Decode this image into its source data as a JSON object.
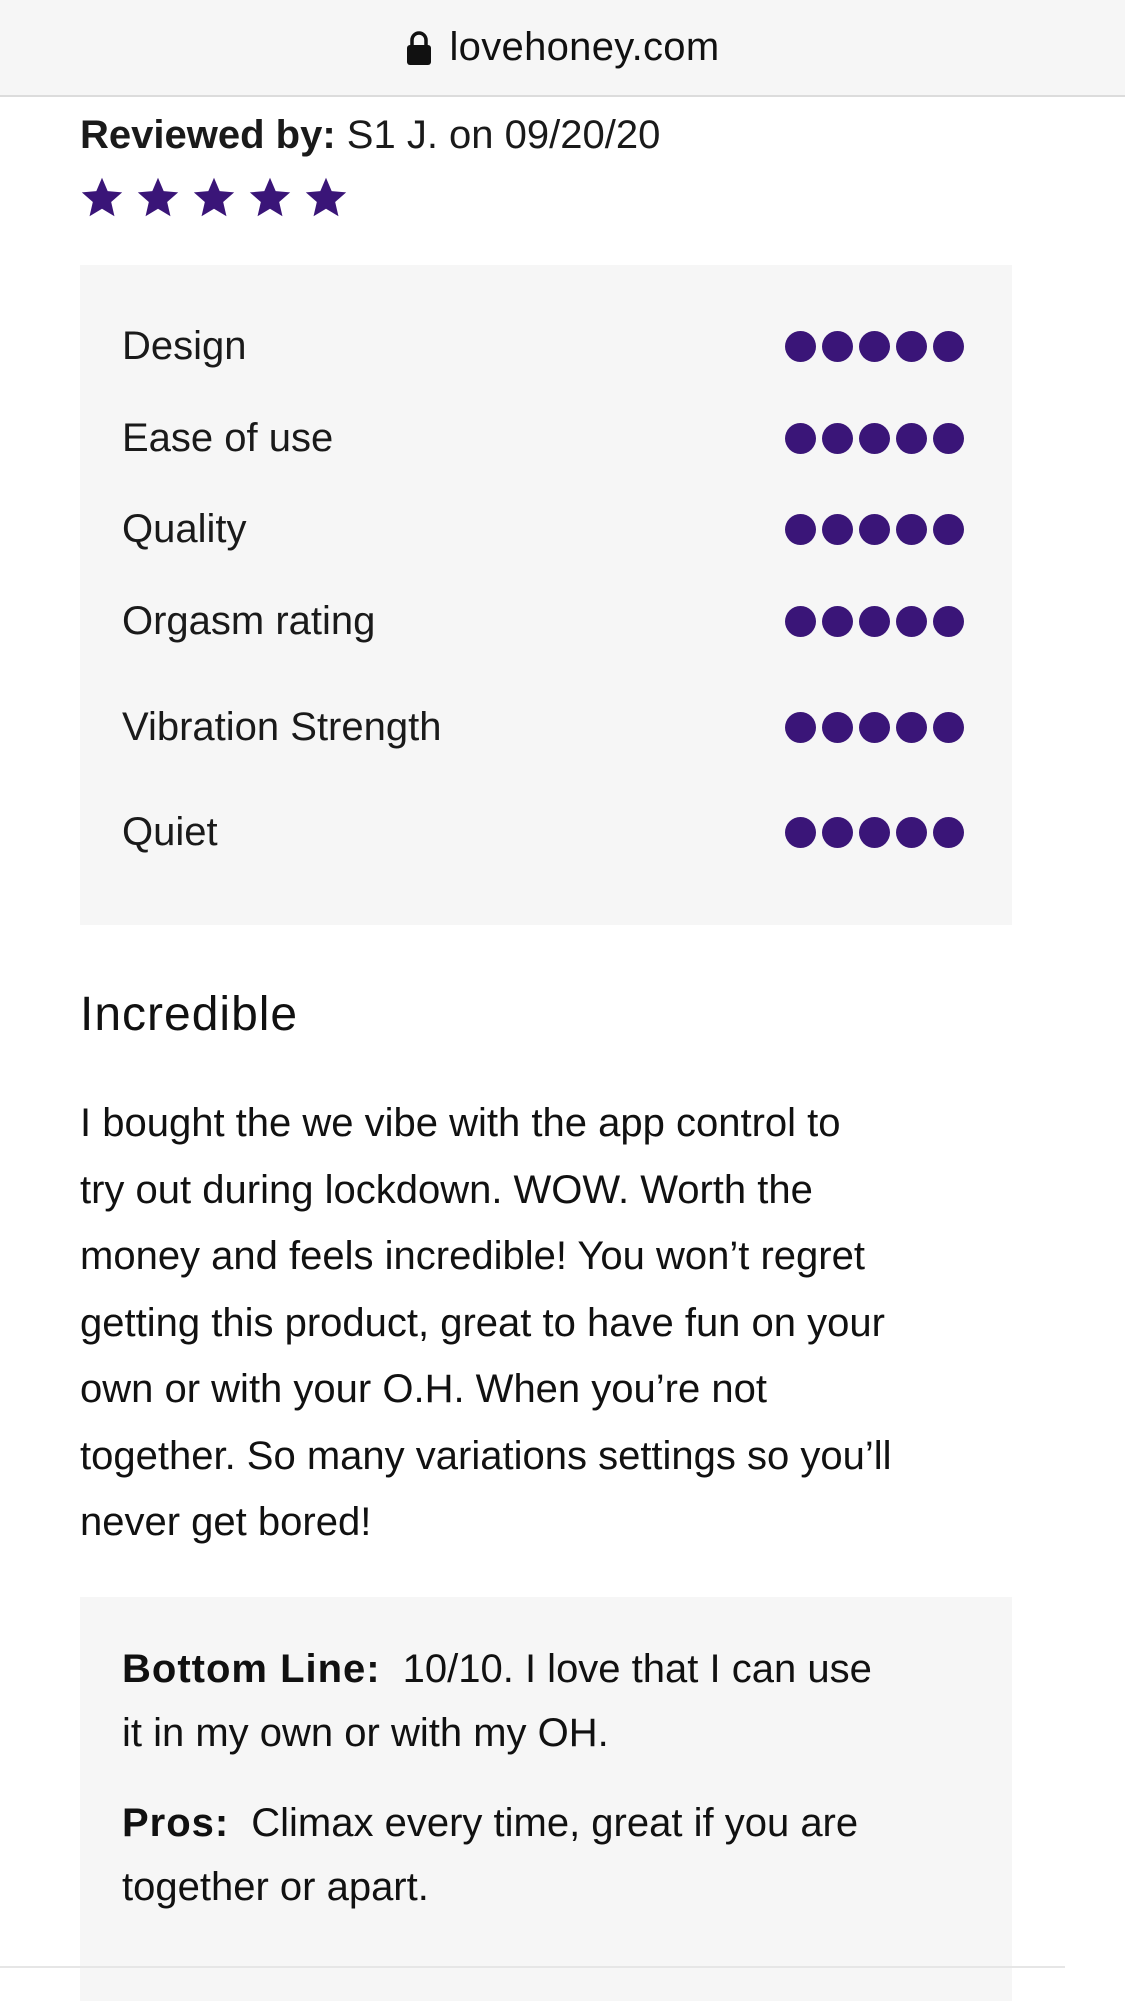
{
  "browser": {
    "url": "lovehoney.com"
  },
  "colors": {
    "accent": "#3a1578",
    "panel": "#f6f6f6"
  },
  "review": {
    "reviewed_by_label": "Reviewed by:",
    "reviewer": "S1 J. on 09/20/20",
    "star_rating": 5,
    "star_max": 5,
    "ratings": [
      {
        "name": "Design",
        "value": 5,
        "max": 5
      },
      {
        "name": "Ease of use",
        "value": 5,
        "max": 5
      },
      {
        "name": "Quality",
        "value": 5,
        "max": 5
      },
      {
        "name": "Orgasm rating",
        "value": 5,
        "max": 5
      },
      {
        "name": "Vibration Strength",
        "value": 5,
        "max": 5
      },
      {
        "name": "Quiet",
        "value": 5,
        "max": 5
      }
    ],
    "title": "Incredible",
    "body_lines": [
      "I bought the we vibe with the app control to",
      "try out during lockdown. WOW. Worth the",
      "money and feels incredible! You won’t regret",
      "getting this product, great to have fun on your",
      "own or with your O.H. When you’re not",
      "together. So many variations settings so you’ll",
      "never get bored!"
    ],
    "bottom_line": {
      "label": "Bottom Line:",
      "lines": [
        "10/10. I love that I can use",
        "it in my own or with my OH."
      ]
    },
    "pros": {
      "label": "Pros:",
      "lines": [
        "Climax every time, great if you are",
        "together or apart."
      ]
    }
  }
}
